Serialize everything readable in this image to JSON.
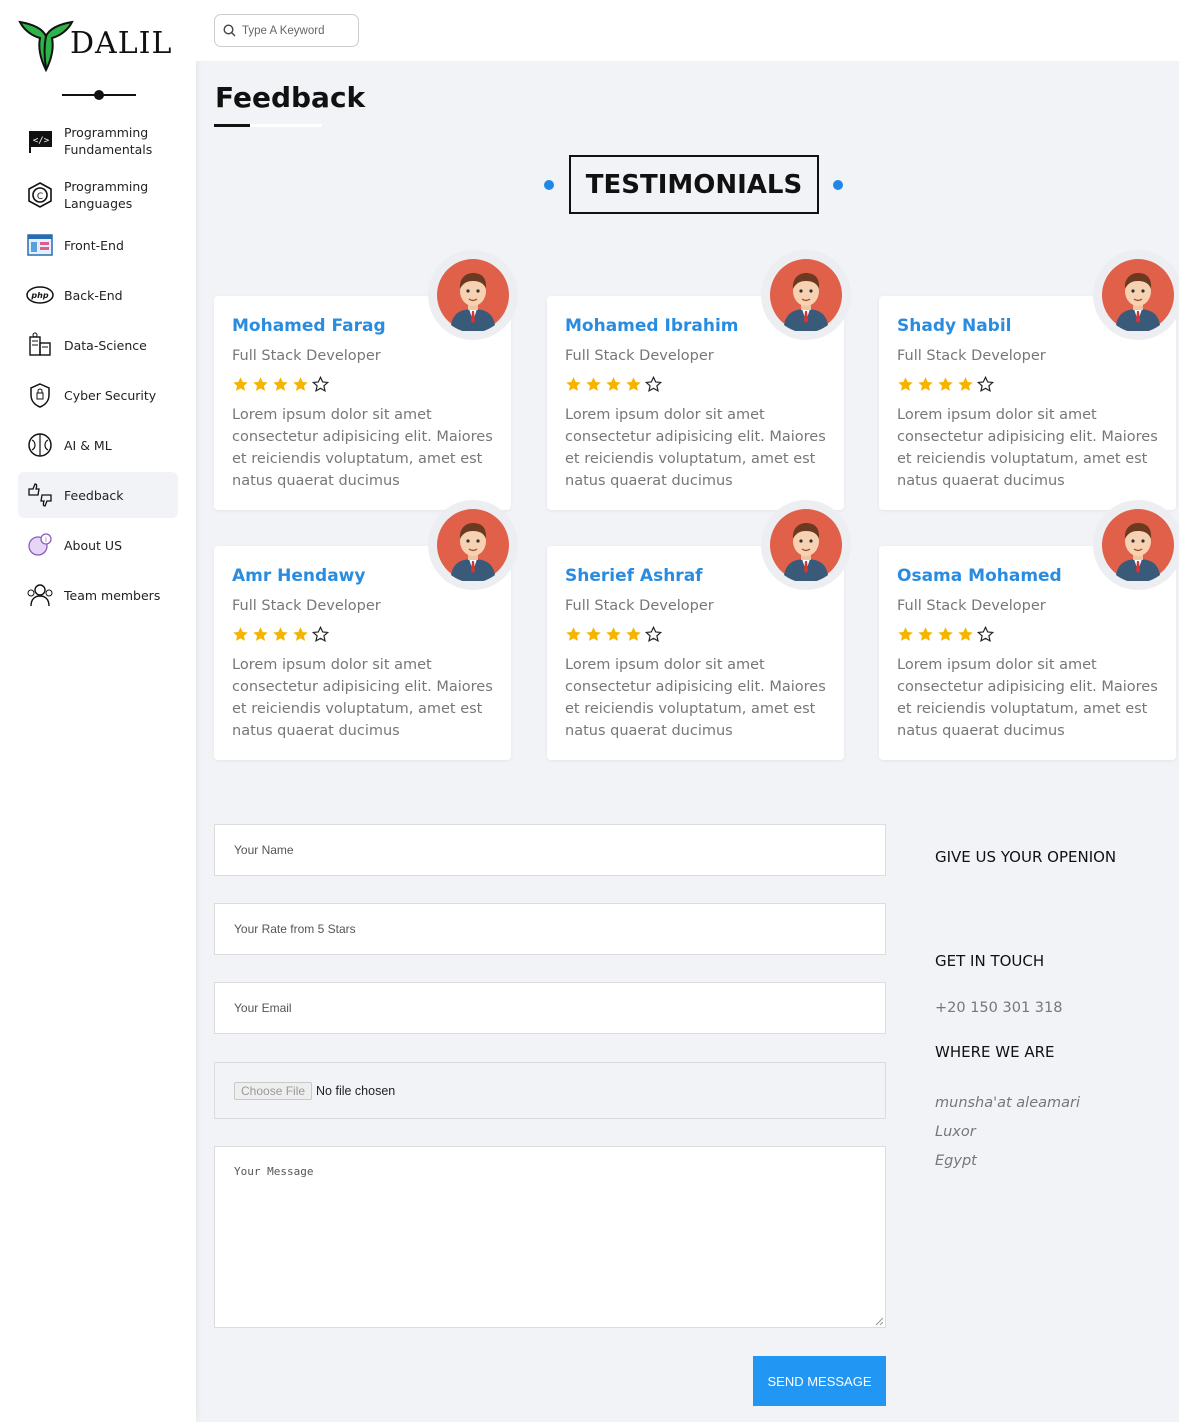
{
  "sidebar": {
    "brand": "DALIL",
    "items": [
      {
        "label": "Programming Fundamentals",
        "icon": "code-flag-icon"
      },
      {
        "label": "Programming Languages",
        "icon": "c-language-icon"
      },
      {
        "label": "Front-End",
        "icon": "browser-window-icon"
      },
      {
        "label": "Back-End",
        "icon": "php-icon"
      },
      {
        "label": "Data-Science",
        "icon": "data-science-icon"
      },
      {
        "label": "Cyber Security",
        "icon": "shield-icon"
      },
      {
        "label": "AI & ML",
        "icon": "brain-icon"
      },
      {
        "label": "Feedback",
        "icon": "thumbs-icon",
        "active": true
      },
      {
        "label": "About US",
        "icon": "info-chat-icon"
      },
      {
        "label": "Team members",
        "icon": "team-icon"
      }
    ]
  },
  "header": {
    "search_placeholder": "Type A Keyword"
  },
  "page": {
    "title": "Feedback",
    "section_heading": "TESTIMONIALS"
  },
  "testimonials": [
    {
      "name": "Mohamed Farag",
      "role": "Full Stack Developer",
      "rating": 4,
      "max_rating": 5,
      "text": "Lorem ipsum dolor sit amet consectetur adipisicing elit. Maiores et reiciendis voluptatum, amet est natus quaerat ducimus"
    },
    {
      "name": "Mohamed Ibrahim",
      "role": "Full Stack Developer",
      "rating": 4,
      "max_rating": 5,
      "text": "Lorem ipsum dolor sit amet consectetur adipisicing elit. Maiores et reiciendis voluptatum, amet est natus quaerat ducimus"
    },
    {
      "name": "Shady Nabil",
      "role": "Full Stack Developer",
      "rating": 4,
      "max_rating": 5,
      "text": "Lorem ipsum dolor sit amet consectetur adipisicing elit. Maiores et reiciendis voluptatum, amet est natus quaerat ducimus"
    },
    {
      "name": "Amr Hendawy",
      "role": "Full Stack Developer",
      "rating": 4,
      "max_rating": 5,
      "text": "Lorem ipsum dolor sit amet consectetur adipisicing elit. Maiores et reiciendis voluptatum, amet est natus quaerat ducimus"
    },
    {
      "name": "Sherief Ashraf",
      "role": "Full Stack Developer",
      "rating": 4,
      "max_rating": 5,
      "text": "Lorem ipsum dolor sit amet consectetur adipisicing elit. Maiores et reiciendis voluptatum, amet est natus quaerat ducimus"
    },
    {
      "name": "Osama Mohamed",
      "role": "Full Stack Developer",
      "rating": 4,
      "max_rating": 5,
      "text": "Lorem ipsum dolor sit amet consectetur adipisicing elit. Maiores et reiciendis voluptatum, amet est natus quaerat ducimus"
    }
  ],
  "form": {
    "name_placeholder": "Your Name",
    "rate_placeholder": "Your Rate from 5 Stars",
    "email_placeholder": "Your Email",
    "file_button": "Choose File",
    "file_status": "No file chosen",
    "message_placeholder": "Your Message",
    "send_label": "SEND MESSAGE"
  },
  "contact": {
    "opinion_heading": "GIVE US YOUR OPENION",
    "touch_heading": "GET IN TOUCH",
    "phone": "+20 150 301 318",
    "where_heading": "WHERE WE ARE",
    "address": [
      "munsha'at aleamari",
      "Luxor",
      "Egypt"
    ]
  },
  "colors": {
    "accent": "#2196f3",
    "name_blue": "#2a8ce0",
    "star": "#f5b400",
    "logo_green": "#2db34a",
    "background": "#f1f3f7"
  }
}
